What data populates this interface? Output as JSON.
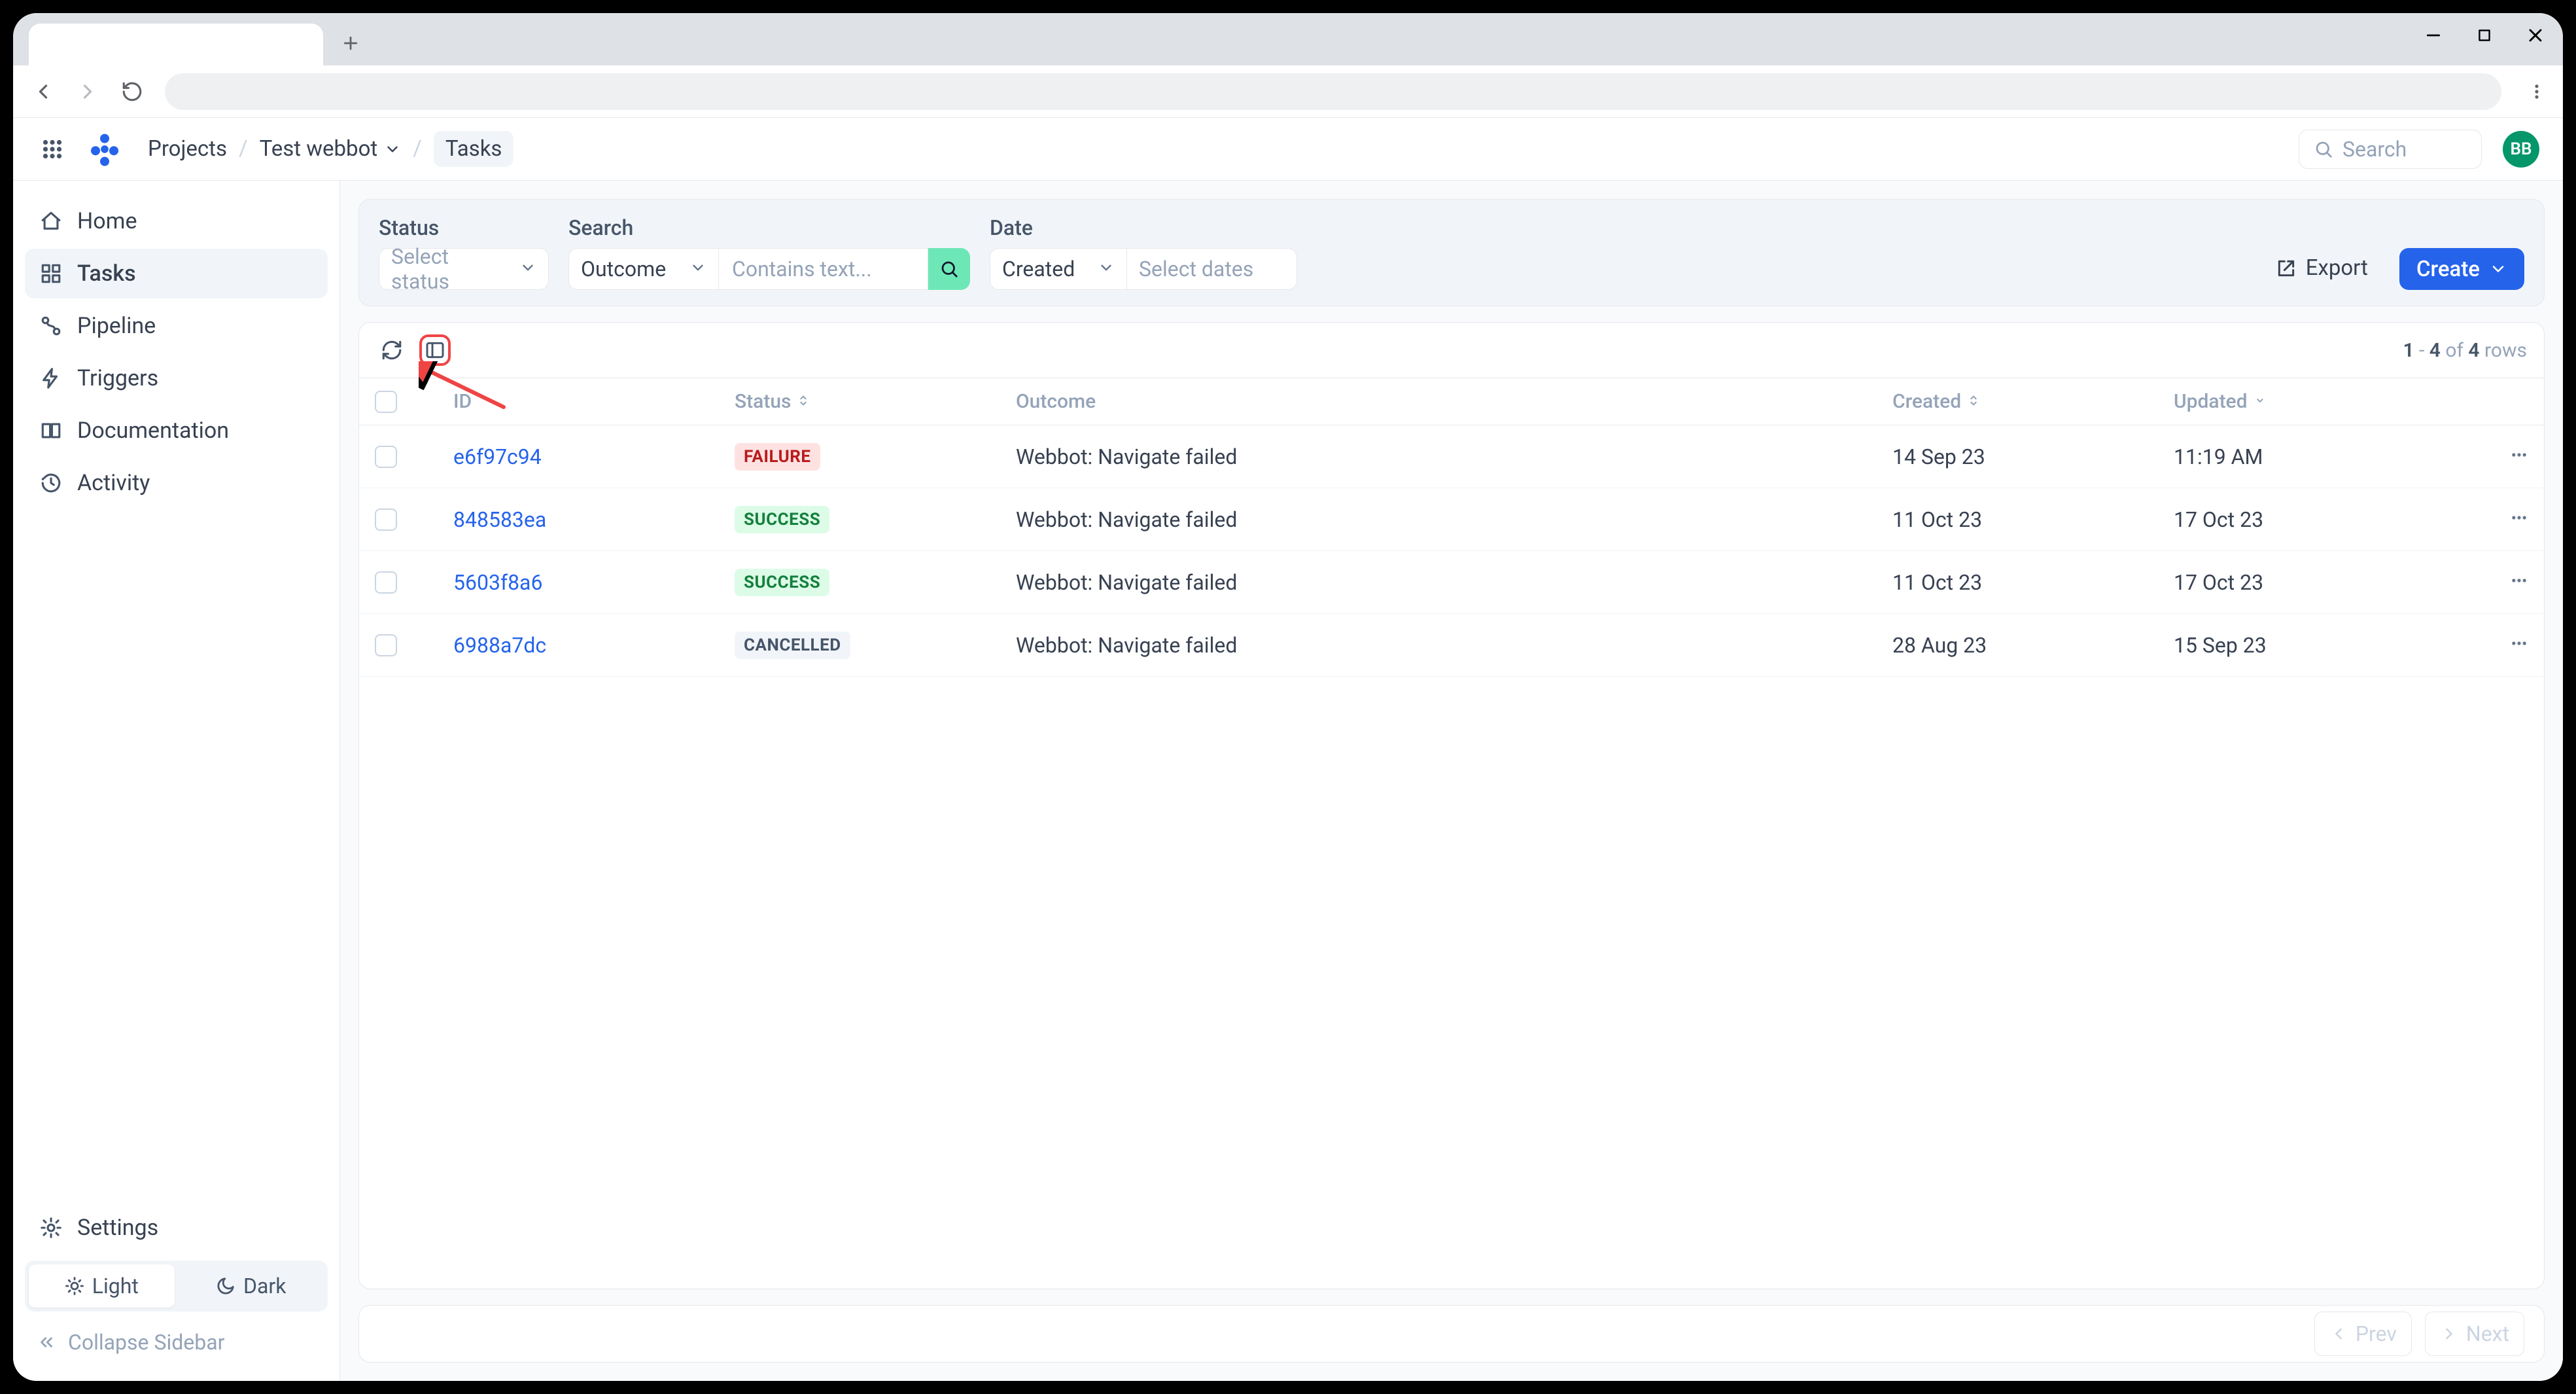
{
  "breadcrumbs": {
    "root": "Projects",
    "project": "Test webbot",
    "page": "Tasks"
  },
  "header": {
    "search_placeholder": "Search",
    "avatar_initials": "BB"
  },
  "sidebar": {
    "items": [
      {
        "label": "Home"
      },
      {
        "label": "Tasks"
      },
      {
        "label": "Pipeline"
      },
      {
        "label": "Triggers"
      },
      {
        "label": "Documentation"
      },
      {
        "label": "Activity"
      }
    ],
    "settings_label": "Settings",
    "theme": {
      "light": "Light",
      "dark": "Dark"
    },
    "collapse_label": "Collapse Sidebar"
  },
  "filters": {
    "status_label": "Status",
    "status_placeholder": "Select status",
    "search_label": "Search",
    "search_scope": "Outcome",
    "search_placeholder": "Contains text...",
    "date_label": "Date",
    "date_scope": "Created",
    "date_placeholder": "Select dates",
    "export_label": "Export",
    "create_label": "Create"
  },
  "table": {
    "columns": {
      "id": "ID",
      "status": "Status",
      "outcome": "Outcome",
      "created": "Created",
      "updated": "Updated"
    },
    "rows": [
      {
        "id": "e6f97c94",
        "status": "FAILURE",
        "outcome": "Webbot: Navigate failed",
        "created": "14 Sep 23",
        "updated": "11:19 AM"
      },
      {
        "id": "848583ea",
        "status": "SUCCESS",
        "outcome": "Webbot: Navigate failed",
        "created": "11 Oct 23",
        "updated": "17 Oct 23"
      },
      {
        "id": "5603f8a6",
        "status": "SUCCESS",
        "outcome": "Webbot: Navigate failed",
        "created": "11 Oct 23",
        "updated": "17 Oct 23"
      },
      {
        "id": "6988a7dc",
        "status": "CANCELLED",
        "outcome": "Webbot: Navigate failed",
        "created": "28 Aug 23",
        "updated": "15 Sep 23"
      }
    ],
    "rowcount": {
      "from": "1",
      "to": "4",
      "of_word": "of",
      "total": "4",
      "rows_word": "rows"
    }
  },
  "pager": {
    "prev": "Prev",
    "next": "Next"
  }
}
